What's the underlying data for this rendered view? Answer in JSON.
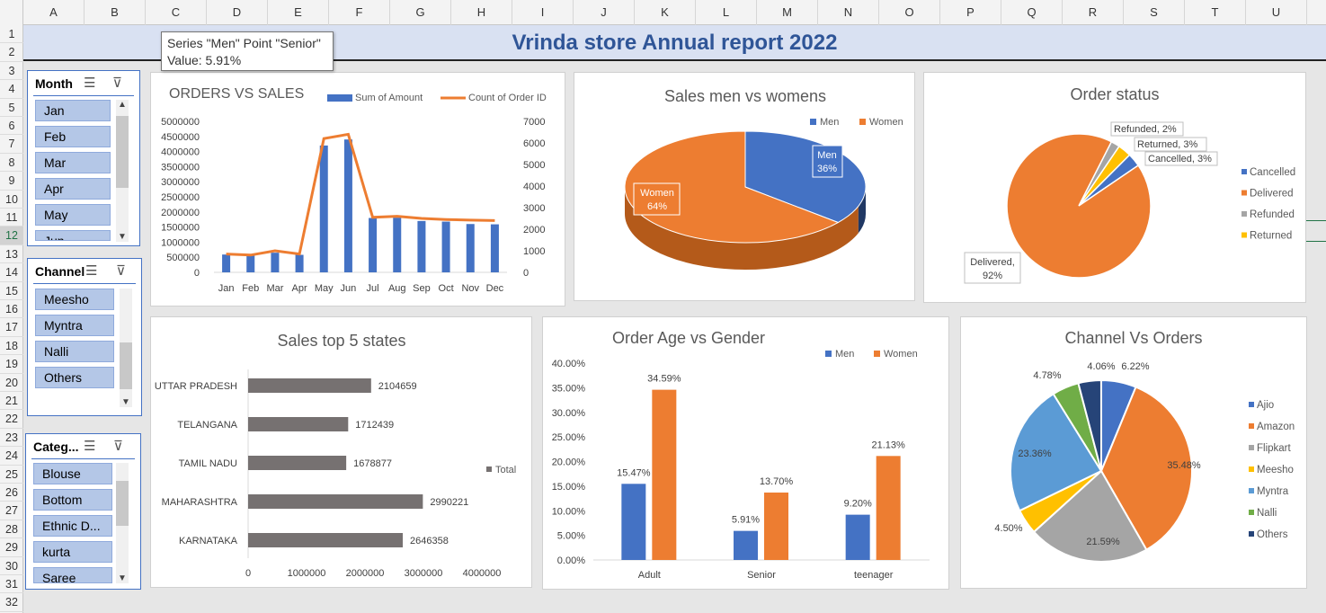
{
  "columns": [
    "A",
    "B",
    "C",
    "D",
    "E",
    "F",
    "G",
    "H",
    "I",
    "J",
    "K",
    "L",
    "M",
    "N",
    "O",
    "P",
    "Q",
    "R",
    "S",
    "T",
    "U"
  ],
  "rows": [
    "1",
    "2",
    "3",
    "4",
    "5",
    "6",
    "7",
    "8",
    "9",
    "10",
    "11",
    "12",
    "13",
    "14",
    "15",
    "16",
    "17",
    "18",
    "19",
    "20",
    "21",
    "22",
    "23",
    "24",
    "25",
    "26",
    "27",
    "28",
    "29",
    "30",
    "31",
    "32"
  ],
  "selected_row": "12",
  "report_title": "Vrinda store Annual report 2022",
  "tooltip": {
    "line1": "Series \"Men\" Point \"Senior\"",
    "line2": "Value: 5.91%"
  },
  "slicers": {
    "month": {
      "title": "Month",
      "items": [
        "Jan",
        "Feb",
        "Mar",
        "Apr",
        "May",
        "Jun"
      ]
    },
    "channel": {
      "title": "Channel",
      "items": [
        "Meesho",
        "Myntra",
        "Nalli",
        "Others"
      ]
    },
    "category": {
      "title": "Categ...",
      "items": [
        "Blouse",
        "Bottom",
        "Ethnic D...",
        "kurta",
        "Saree"
      ]
    }
  },
  "chart_data": [
    {
      "id": "orders_vs_sales",
      "type": "bar",
      "title": "ORDERS VS SALES",
      "categories": [
        "Jan",
        "Feb",
        "Mar",
        "Apr",
        "May",
        "Jun",
        "Jul",
        "Aug",
        "Sep",
        "Oct",
        "Nov",
        "Dec"
      ],
      "series": [
        {
          "name": "Sum of Amount",
          "type": "bar",
          "axis": "left",
          "values": [
            590000,
            560000,
            650000,
            580000,
            4200000,
            4400000,
            1800000,
            1810000,
            1700000,
            1680000,
            1600000,
            1590000
          ],
          "color": "#4472c4"
        },
        {
          "name": "Count of Order ID",
          "type": "line",
          "axis": "right",
          "values": [
            850,
            800,
            1000,
            850,
            6200,
            6400,
            2550,
            2600,
            2500,
            2450,
            2420,
            2400
          ],
          "color": "#ed7d31"
        }
      ],
      "y_ticks": [
        "5000000",
        "4500000",
        "4000000",
        "3500000",
        "3000000",
        "2500000",
        "2000000",
        "1500000",
        "1000000",
        "500000",
        "0"
      ],
      "y2_ticks": [
        "7000",
        "6000",
        "5000",
        "4000",
        "3000",
        "2000",
        "1000",
        "0"
      ],
      "ylim": [
        0,
        5000000
      ],
      "y2lim": [
        0,
        7000
      ],
      "legend": "top-right",
      "grid": false
    },
    {
      "id": "sales_men_women",
      "type": "pie",
      "title": "Sales men vs womens",
      "labels": [
        "Men",
        "Women"
      ],
      "values": [
        36,
        64
      ],
      "data_labels": [
        [
          "Men",
          "36%"
        ],
        [
          "Women",
          "64%"
        ]
      ],
      "colors": [
        "#4472c4",
        "#ed7d31"
      ],
      "legend": "top-right"
    },
    {
      "id": "order_status",
      "type": "pie",
      "title": "Order status",
      "labels": [
        "Cancelled",
        "Delivered",
        "Refunded",
        "Returned"
      ],
      "values": [
        3,
        92,
        2,
        3
      ],
      "data_labels": [
        [
          "Cancelled, 3%"
        ],
        [
          "Delivered,",
          "92%"
        ],
        [
          "Refunded, 2%"
        ],
        [
          "Returned, 3%"
        ]
      ],
      "colors": [
        "#4472c4",
        "#ed7d31",
        "#a5a5a5",
        "#ffc000"
      ],
      "legend": "right"
    },
    {
      "id": "sales_top5_states",
      "type": "bar",
      "orientation": "horizontal",
      "title": "Sales top 5 states",
      "categories": [
        "UTTAR PRADESH",
        "TELANGANA",
        "TAMIL NADU",
        "MAHARASHTRA",
        "KARNATAKA"
      ],
      "series": [
        {
          "name": "Total",
          "values": [
            2104659,
            1712439,
            1678877,
            2990221,
            2646358
          ]
        }
      ],
      "x_ticks": [
        "0",
        "1000000",
        "2000000",
        "3000000",
        "4000000"
      ],
      "xlim": [
        0,
        4000000
      ],
      "color": "#767171",
      "legend": "right"
    },
    {
      "id": "order_age_gender",
      "type": "bar",
      "title": "Order Age vs Gender",
      "categories": [
        "Adult",
        "Senior",
        "teenager"
      ],
      "series": [
        {
          "name": "Men",
          "values": [
            15.47,
            5.91,
            9.2
          ],
          "labels": [
            "15.47%",
            "5.91%",
            "9.20%"
          ],
          "color": "#4472c4"
        },
        {
          "name": "Women",
          "values": [
            34.59,
            13.7,
            21.13
          ],
          "labels": [
            "34.59%",
            "13.70%",
            "21.13%"
          ],
          "color": "#ed7d31"
        }
      ],
      "y_ticks": [
        "40.00%",
        "35.00%",
        "30.00%",
        "25.00%",
        "20.00%",
        "15.00%",
        "10.00%",
        "5.00%",
        "0.00%"
      ],
      "ylim": [
        0,
        40
      ],
      "legend": "top-right"
    },
    {
      "id": "channel_vs_orders",
      "type": "pie",
      "title": "Channel Vs Orders",
      "labels": [
        "Ajio",
        "Amazon",
        "Flipkart",
        "Meesho",
        "Myntra",
        "Nalli",
        "Others"
      ],
      "values": [
        6.22,
        35.48,
        21.59,
        4.5,
        23.36,
        4.78,
        4.06
      ],
      "data_labels": [
        "6.22%",
        "35.48%",
        "21.59%",
        "4.50%",
        "23.36%",
        "4.78%",
        "4.06%"
      ],
      "colors": [
        "#4472c4",
        "#ed7d31",
        "#a5a5a5",
        "#ffc000",
        "#5b9bd5",
        "#70ad47",
        "#264478"
      ],
      "legend": "right"
    }
  ]
}
